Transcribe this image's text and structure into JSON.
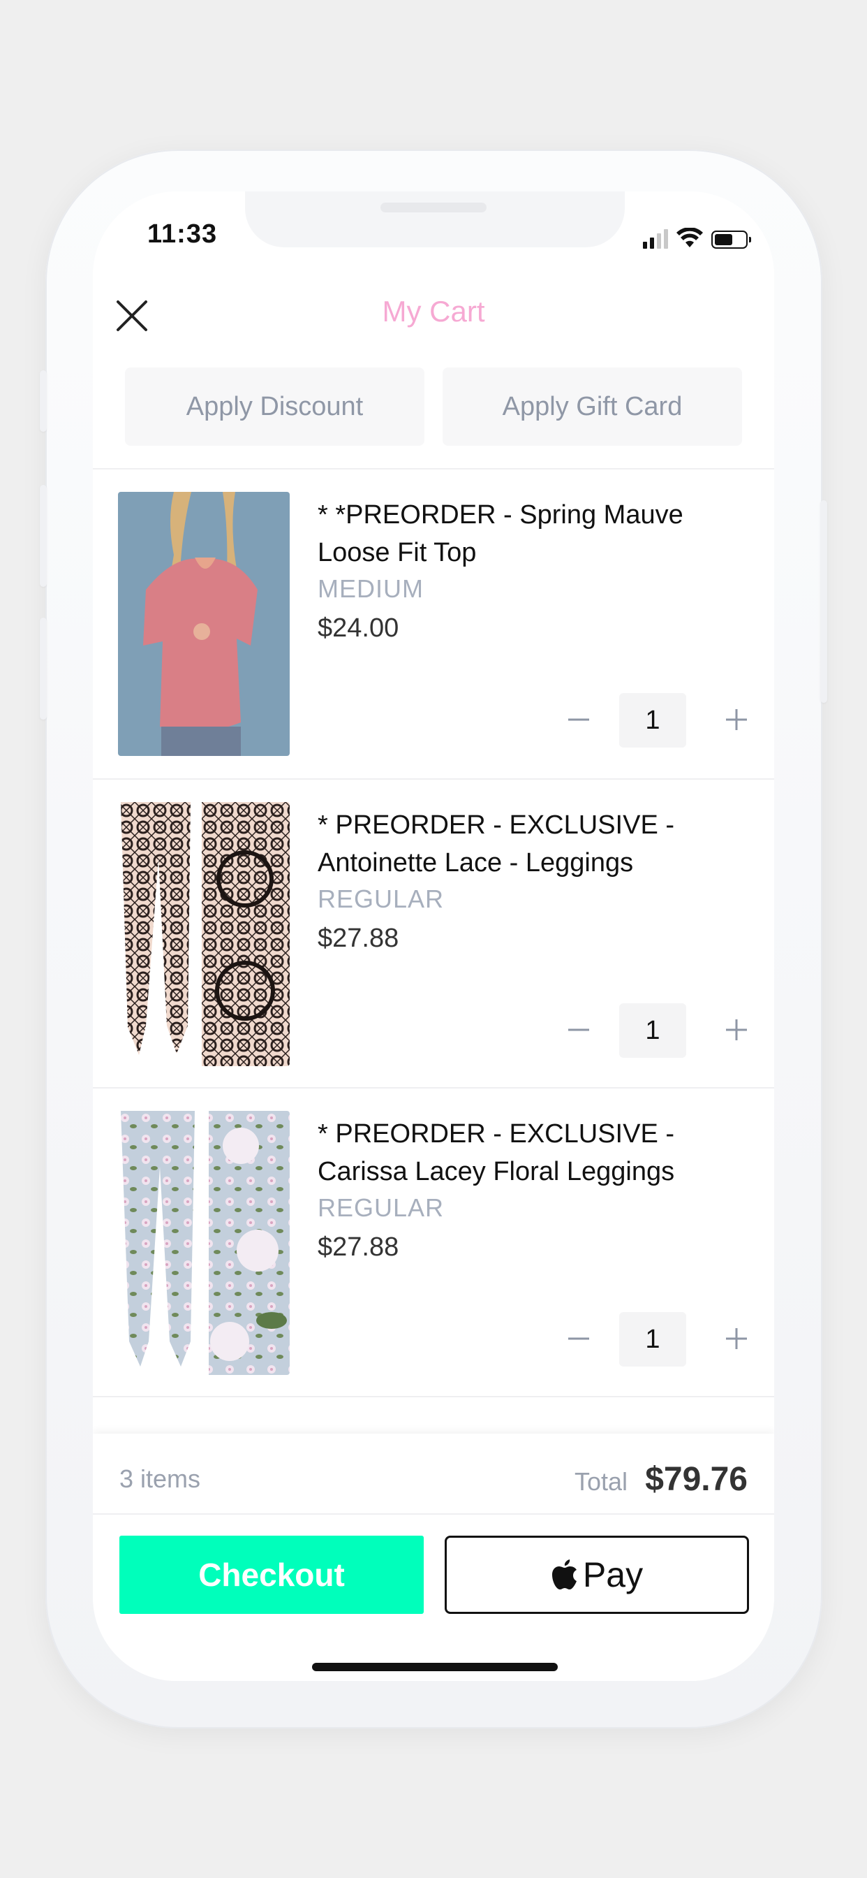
{
  "status_bar": {
    "time": "11:33"
  },
  "header": {
    "title": "My Cart",
    "close_icon": "close-icon"
  },
  "apply": {
    "discount_label": "Apply Discount",
    "gift_card_label": "Apply Gift Card"
  },
  "items": [
    {
      "name": "* *PREORDER - Spring Mauve Loose Fit Top",
      "variant": "MEDIUM",
      "price": "$24.00",
      "qty": "1"
    },
    {
      "name": "* PREORDER - EXCLUSIVE - Antoinette Lace - Leggings",
      "variant": "REGULAR",
      "price": "$27.88",
      "qty": "1"
    },
    {
      "name": "* PREORDER - EXCLUSIVE - Carissa Lacey Floral Leggings",
      "variant": "REGULAR",
      "price": "$27.88",
      "qty": "1"
    }
  ],
  "summary": {
    "items_count": "3 items",
    "total_label": "Total",
    "total_value": "$79.76"
  },
  "actions": {
    "checkout_label": "Checkout",
    "applepay_label": "Pay"
  },
  "colors": {
    "title": "#f6a9d3",
    "checkout": "#00ffbb",
    "muted": "#9aa1ae"
  }
}
